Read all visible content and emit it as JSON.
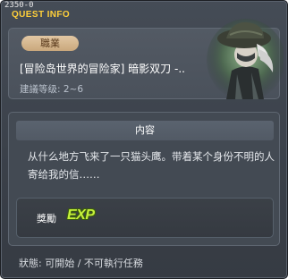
{
  "window": {
    "id_label": "2350-0",
    "title": "QUEST INFO"
  },
  "header": {
    "job_badge": "職業",
    "quest_name": "[冒险岛世界的冒险家] 暗影双刀 -..",
    "required_level": "建議等级: 2~6"
  },
  "content": {
    "section_title": "内容",
    "description": "从什么地方飞来了一只猫头鹰。带着某个身份不明的人寄给我的信……",
    "reward": {
      "label": "獎勵",
      "icon_text": "EXP"
    }
  },
  "footer": {
    "status": "狀態: 可開始 / 不可執行任務"
  },
  "colors": {
    "title": "#ffd03a",
    "job_badge_bg": "#d6b890",
    "exp_icon": "#c6f13a"
  },
  "icons": {
    "portrait": "character-portrait",
    "reward": "exp-icon"
  }
}
